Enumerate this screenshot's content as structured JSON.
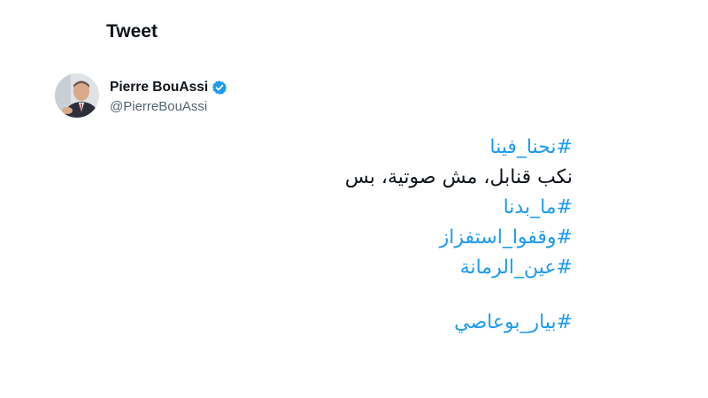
{
  "header": {
    "title": "Tweet"
  },
  "author": {
    "display_name": "Pierre BouAssi",
    "handle": "@PierreBouAssi",
    "verified_icon": "verified-badge-icon",
    "accent_color": "#1d9bf0"
  },
  "tweet": {
    "lines": [
      "#نحنا_فينا",
      "نكب قنابل، مش صوتية، بس",
      "#ما_بدنا",
      "#وقفوا_استفزاز",
      "#عين_الرمانة",
      "#بيار_بوعاصي"
    ]
  }
}
